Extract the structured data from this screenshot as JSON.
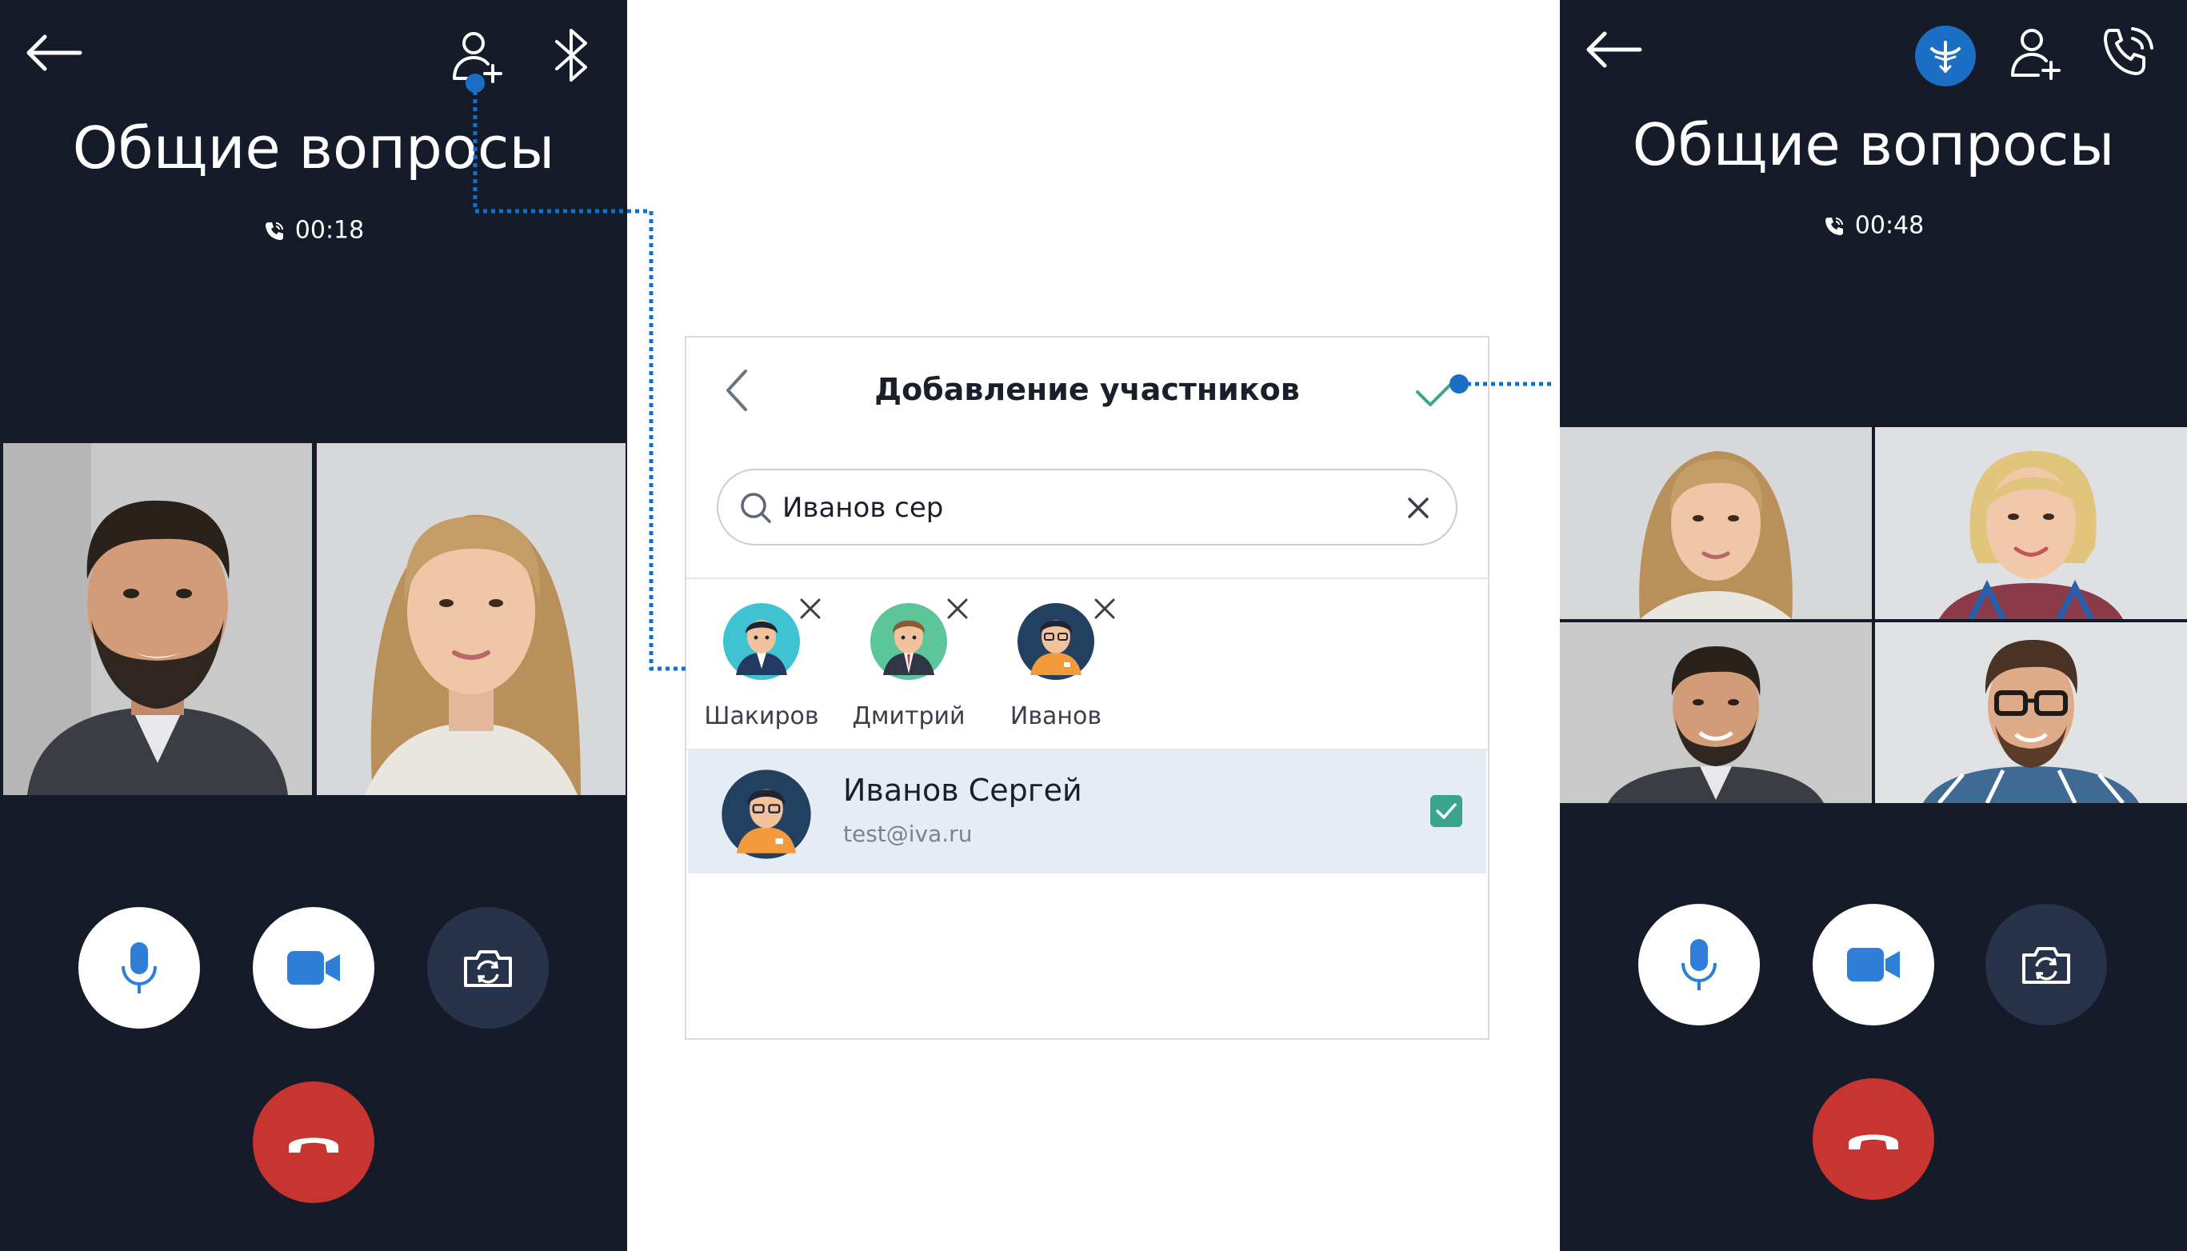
{
  "left_screen": {
    "title": "Общие вопросы",
    "timer": "00:18"
  },
  "dialog": {
    "title": "Добавление участников",
    "search": {
      "value": "Иванов сер",
      "placeholder": ""
    },
    "selected": [
      {
        "name": "Шакиров"
      },
      {
        "name": "Дмитрий"
      },
      {
        "name": "Иванов"
      }
    ],
    "result": {
      "name": "Иванов Сергей",
      "email": "test@iva.ru",
      "checked": true
    }
  },
  "right_screen": {
    "title": "Общие вопросы",
    "timer": "00:48"
  },
  "colors": {
    "screen_bg": "#151b28",
    "accent_blue": "#1a6fc4",
    "mic_blue": "#2f7fd8",
    "hangup_red": "#c8342f",
    "check_green": "#3aa58c",
    "dark_control": "#26334a"
  },
  "icons": [
    "back-arrow-icon",
    "add-user-icon",
    "bluetooth-icon",
    "phone-in-call-icon",
    "microphone-icon",
    "video-camera-icon",
    "switch-camera-icon",
    "hangup-icon",
    "search-icon",
    "clear-icon",
    "chevron-left-icon",
    "checkmark-icon",
    "remove-icon",
    "antenna-icon",
    "call-settings-icon"
  ]
}
